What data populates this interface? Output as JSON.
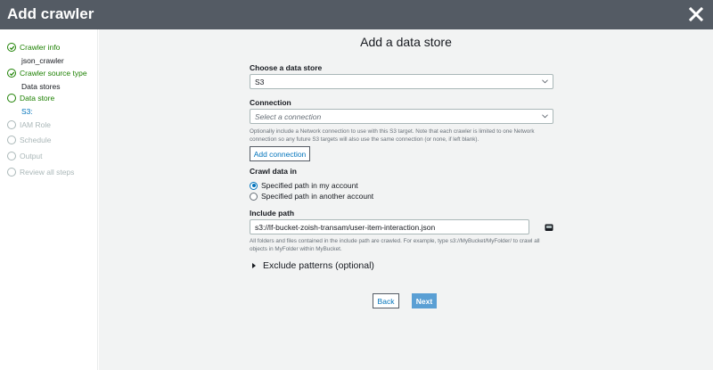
{
  "header": {
    "title": "Add crawler"
  },
  "sidebar": {
    "steps": [
      {
        "label": "Crawler info",
        "state": "done",
        "detail": "json_crawler"
      },
      {
        "label": "Crawler source type",
        "state": "done",
        "detail": "Data stores"
      },
      {
        "label": "Data store",
        "state": "active",
        "detail": "S3:"
      },
      {
        "label": "IAM Role",
        "state": "todo"
      },
      {
        "label": "Schedule",
        "state": "todo"
      },
      {
        "label": "Output",
        "state": "todo"
      },
      {
        "label": "Review all steps",
        "state": "todo"
      }
    ]
  },
  "main": {
    "title": "Add a data store",
    "data_store": {
      "label": "Choose a data store",
      "value": "S3"
    },
    "connection": {
      "label": "Connection",
      "placeholder": "Select a connection",
      "help": "Optionally include a Network connection to use with this S3 target. Note that each crawler is limited to one Network connection so any future S3 targets will also use the same connection (or none, if left blank).",
      "add_button": "Add connection"
    },
    "crawl": {
      "label": "Crawl data in",
      "options": [
        {
          "label": "Specified path in my account",
          "selected": true
        },
        {
          "label": "Specified path in another account",
          "selected": false
        }
      ]
    },
    "include_path": {
      "label": "Include path",
      "value": "s3://lf-bucket-zoish-transam/user-item-interaction.json",
      "help": "All folders and files contained in the include path are crawled. For example, type s3://MyBucket/MyFolder/ to crawl all objects in MyFolder within MyBucket."
    },
    "exclude_label": "Exclude patterns (optional)",
    "back_label": "Back",
    "next_label": "Next"
  },
  "colors": {
    "header_bg": "#545b64",
    "success_green": "#1d8102",
    "link_blue": "#0073bb",
    "primary_button": "#5a9fd4",
    "disabled_gray": "#aab7b8"
  }
}
